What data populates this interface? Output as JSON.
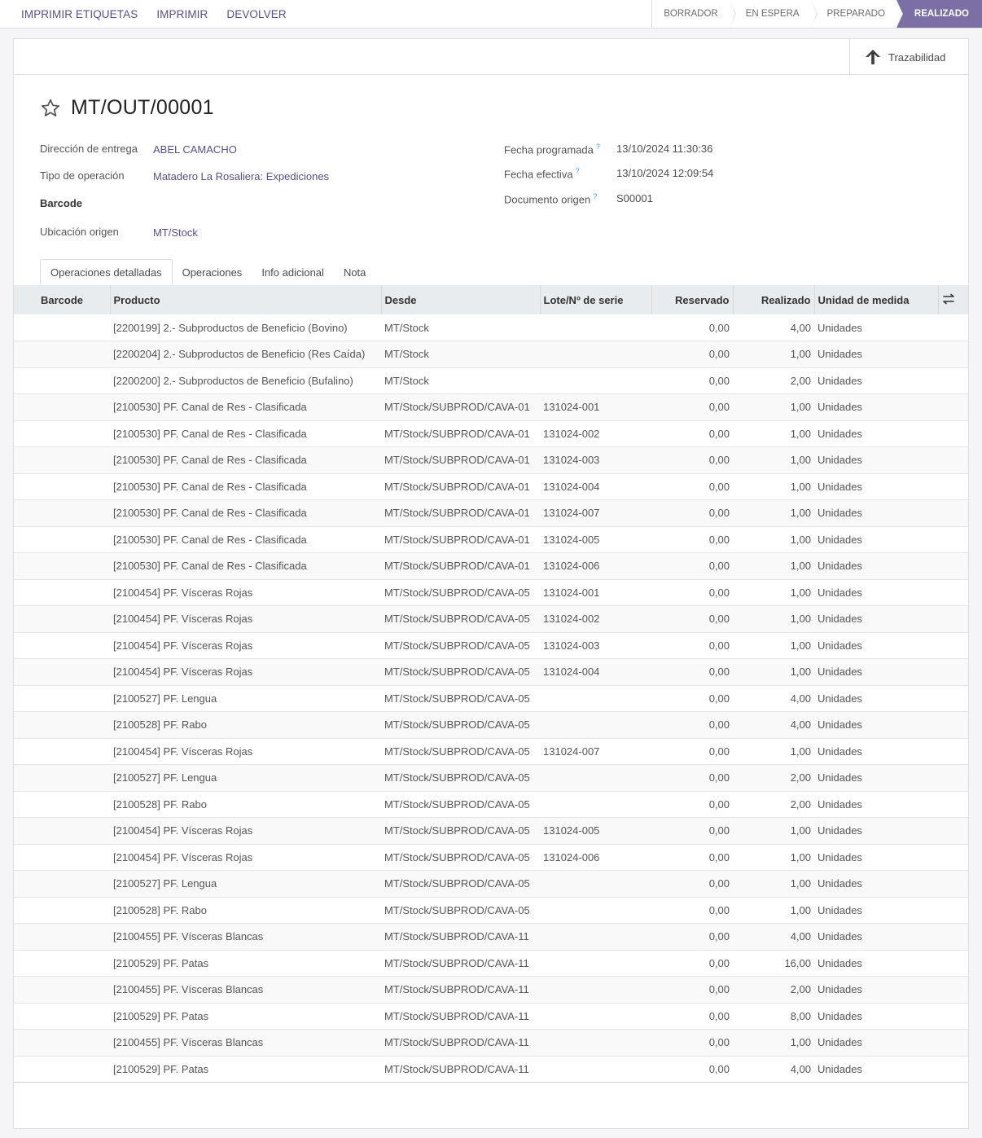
{
  "actions": [
    "IMPRIMIR ETIQUETAS",
    "IMPRIMIR",
    "DEVOLVER"
  ],
  "stages": [
    {
      "label": "BORRADOR",
      "active": false
    },
    {
      "label": "EN ESPERA",
      "active": false
    },
    {
      "label": "PREPARADO",
      "active": false
    },
    {
      "label": "REALIZADO",
      "active": true
    }
  ],
  "smart_button": {
    "label": "Trazabilidad",
    "icon": "arrow-up-icon"
  },
  "record": {
    "title": "MT/OUT/00001"
  },
  "fields_left": [
    {
      "label": "Dirección de entrega",
      "value": "ABEL CAMACHO"
    },
    {
      "label": "Tipo de operación",
      "value": "Matadero La Rosaliera: Expediciones"
    },
    {
      "label": "Barcode",
      "value": ""
    },
    {
      "label": "Ubicación origen",
      "value": "MT/Stock"
    }
  ],
  "fields_right": [
    {
      "label": "Fecha programada",
      "help": "?",
      "value": "13/10/2024 11:30:36"
    },
    {
      "label": "Fecha efectiva",
      "help": "?",
      "value": "13/10/2024 12:09:54"
    },
    {
      "label": "Documento origen",
      "help": "?",
      "value": "S00001"
    }
  ],
  "tabs": [
    "Operaciones detalladas",
    "Operaciones",
    "Info adicional",
    "Nota"
  ],
  "table": {
    "columns": [
      "Barcode",
      "Producto",
      "Desde",
      "Lote/Nº de serie",
      "Reservado",
      "Realizado",
      "Unidad de medida"
    ],
    "rows": [
      [
        "",
        "[2200199] 2.- Subproductos de Beneficio (Bovino)",
        "MT/Stock",
        "",
        "0,00",
        "4,00",
        "Unidades"
      ],
      [
        "",
        "[2200204] 2.- Subproductos de Beneficio (Res Caída)",
        "MT/Stock",
        "",
        "0,00",
        "1,00",
        "Unidades"
      ],
      [
        "",
        "[2200200] 2.- Subproductos de Beneficio (Bufalino)",
        "MT/Stock",
        "",
        "0,00",
        "2,00",
        "Unidades"
      ],
      [
        "",
        "[2100530] PF. Canal de Res - Clasificada",
        "MT/Stock/SUBPROD/CAVA-01",
        "131024-001",
        "0,00",
        "1,00",
        "Unidades"
      ],
      [
        "",
        "[2100530] PF. Canal de Res - Clasificada",
        "MT/Stock/SUBPROD/CAVA-01",
        "131024-002",
        "0,00",
        "1,00",
        "Unidades"
      ],
      [
        "",
        "[2100530] PF. Canal de Res - Clasificada",
        "MT/Stock/SUBPROD/CAVA-01",
        "131024-003",
        "0,00",
        "1,00",
        "Unidades"
      ],
      [
        "",
        "[2100530] PF. Canal de Res - Clasificada",
        "MT/Stock/SUBPROD/CAVA-01",
        "131024-004",
        "0,00",
        "1,00",
        "Unidades"
      ],
      [
        "",
        "[2100530] PF. Canal de Res - Clasificada",
        "MT/Stock/SUBPROD/CAVA-01",
        "131024-007",
        "0,00",
        "1,00",
        "Unidades"
      ],
      [
        "",
        "[2100530] PF. Canal de Res - Clasificada",
        "MT/Stock/SUBPROD/CAVA-01",
        "131024-005",
        "0,00",
        "1,00",
        "Unidades"
      ],
      [
        "",
        "[2100530] PF. Canal de Res - Clasificada",
        "MT/Stock/SUBPROD/CAVA-01",
        "131024-006",
        "0,00",
        "1,00",
        "Unidades"
      ],
      [
        "",
        "[2100454] PF. Vísceras Rojas",
        "MT/Stock/SUBPROD/CAVA-05",
        "131024-001",
        "0,00",
        "1,00",
        "Unidades"
      ],
      [
        "",
        "[2100454] PF. Vísceras Rojas",
        "MT/Stock/SUBPROD/CAVA-05",
        "131024-002",
        "0,00",
        "1,00",
        "Unidades"
      ],
      [
        "",
        "[2100454] PF. Vísceras Rojas",
        "MT/Stock/SUBPROD/CAVA-05",
        "131024-003",
        "0,00",
        "1,00",
        "Unidades"
      ],
      [
        "",
        "[2100454] PF. Vísceras Rojas",
        "MT/Stock/SUBPROD/CAVA-05",
        "131024-004",
        "0,00",
        "1,00",
        "Unidades"
      ],
      [
        "",
        "[2100527] PF. Lengua",
        "MT/Stock/SUBPROD/CAVA-05",
        "",
        "0,00",
        "4,00",
        "Unidades"
      ],
      [
        "",
        "[2100528] PF. Rabo",
        "MT/Stock/SUBPROD/CAVA-05",
        "",
        "0,00",
        "4,00",
        "Unidades"
      ],
      [
        "",
        "[2100454] PF. Vísceras Rojas",
        "MT/Stock/SUBPROD/CAVA-05",
        "131024-007",
        "0,00",
        "1,00",
        "Unidades"
      ],
      [
        "",
        "[2100527] PF. Lengua",
        "MT/Stock/SUBPROD/CAVA-05",
        "",
        "0,00",
        "2,00",
        "Unidades"
      ],
      [
        "",
        "[2100528] PF. Rabo",
        "MT/Stock/SUBPROD/CAVA-05",
        "",
        "0,00",
        "2,00",
        "Unidades"
      ],
      [
        "",
        "[2100454] PF. Vísceras Rojas",
        "MT/Stock/SUBPROD/CAVA-05",
        "131024-005",
        "0,00",
        "1,00",
        "Unidades"
      ],
      [
        "",
        "[2100454] PF. Vísceras Rojas",
        "MT/Stock/SUBPROD/CAVA-05",
        "131024-006",
        "0,00",
        "1,00",
        "Unidades"
      ],
      [
        "",
        "[2100527] PF. Lengua",
        "MT/Stock/SUBPROD/CAVA-05",
        "",
        "0,00",
        "1,00",
        "Unidades"
      ],
      [
        "",
        "[2100528] PF. Rabo",
        "MT/Stock/SUBPROD/CAVA-05",
        "",
        "0,00",
        "1,00",
        "Unidades"
      ],
      [
        "",
        "[2100455] PF. Vísceras Blancas",
        "MT/Stock/SUBPROD/CAVA-11",
        "",
        "0,00",
        "4,00",
        "Unidades"
      ],
      [
        "",
        "[2100529] PF. Patas",
        "MT/Stock/SUBPROD/CAVA-11",
        "",
        "0,00",
        "16,00",
        "Unidades"
      ],
      [
        "",
        "[2100455] PF. Vísceras Blancas",
        "MT/Stock/SUBPROD/CAVA-11",
        "",
        "0,00",
        "2,00",
        "Unidades"
      ],
      [
        "",
        "[2100529] PF. Patas",
        "MT/Stock/SUBPROD/CAVA-11",
        "",
        "0,00",
        "8,00",
        "Unidades"
      ],
      [
        "",
        "[2100455] PF. Vísceras Blancas",
        "MT/Stock/SUBPROD/CAVA-11",
        "",
        "0,00",
        "1,00",
        "Unidades"
      ],
      [
        "",
        "[2100529] PF. Patas",
        "MT/Stock/SUBPROD/CAVA-11",
        "",
        "0,00",
        "4,00",
        "Unidades"
      ]
    ]
  },
  "colors": {
    "accent": "#7c6fa6",
    "link": "#5b4e8c",
    "header_bg": "#e9ecef"
  }
}
